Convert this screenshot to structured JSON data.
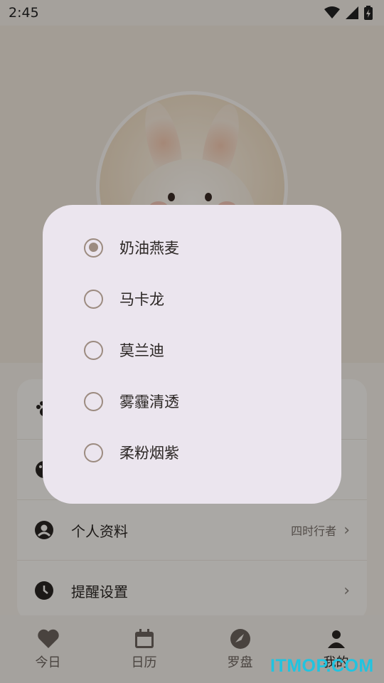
{
  "status_bar": {
    "time": "2:45",
    "icons": [
      "wifi-icon",
      "signal-icon",
      "battery-icon"
    ]
  },
  "settings": {
    "rows": [
      {
        "label": "",
        "icon": "paw-icon"
      },
      {
        "label": "",
        "icon": "palette-icon"
      },
      {
        "label": "个人资料",
        "value": "四时行者",
        "icon": "account-circle-icon"
      },
      {
        "label": "提醒设置",
        "icon": "clock-icon"
      }
    ]
  },
  "bottom_nav": {
    "items": [
      {
        "label": "今日",
        "icon": "heart-icon"
      },
      {
        "label": "日历",
        "icon": "calendar-icon"
      },
      {
        "label": "罗盘",
        "icon": "compass-icon"
      },
      {
        "label": "我的",
        "icon": "person-icon",
        "active": true
      }
    ]
  },
  "theme_dialog": {
    "selected": "奶油燕麦",
    "options": [
      "奶油燕麦",
      "马卡龙",
      "莫兰迪",
      "雾霾清透",
      "柔粉烟紫"
    ]
  },
  "watermark": "ITMOP.COM",
  "colors": {
    "accent": "#9c8b80",
    "dialog_bg": "#ebe5ee",
    "scrim": "rgba(0,0,0,0.32)"
  }
}
